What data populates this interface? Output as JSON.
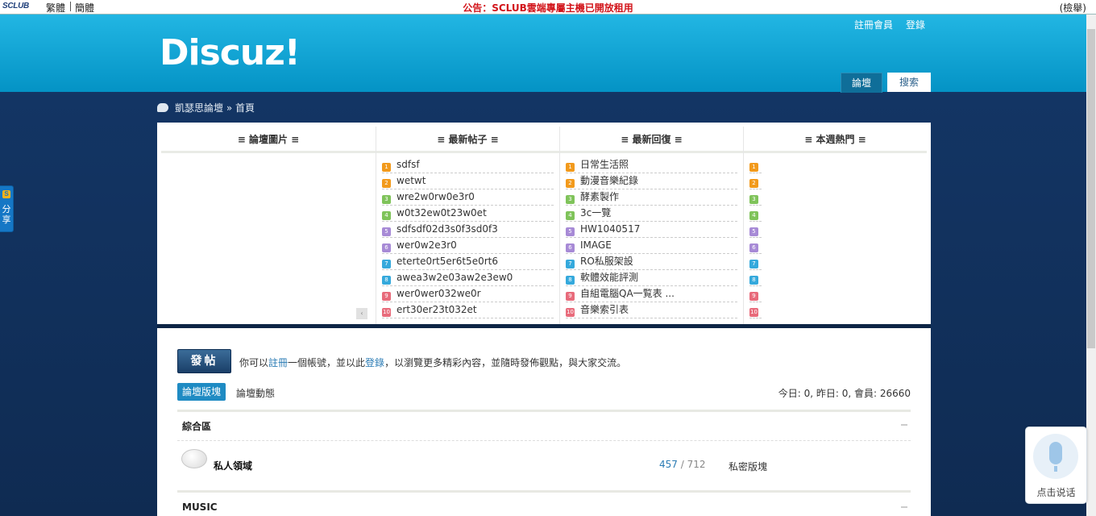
{
  "topbar": {
    "brand": "SCLUB",
    "lang_trad": "繁體",
    "lang_simp": "簡體",
    "announcement": "公告：SCLUB雲端專屬主機已開放租用",
    "lookup": "(檢舉)"
  },
  "header": {
    "logo": "Discuz!",
    "register": "註冊會員",
    "login": "登錄",
    "nav": [
      "論壇",
      "搜索"
    ]
  },
  "breadcrumb": {
    "site": "凱瑟思論壇",
    "sep": "»",
    "current": "首頁"
  },
  "portal": {
    "columns": [
      {
        "title": "≡ 論壇圖片 ≡",
        "items": []
      },
      {
        "title": "≡ 最新帖子 ≡",
        "items": [
          "sdfsf",
          "wetwt",
          "wre2w0rw0e3r0",
          "w0t32ew0t23w0et",
          "sdfsdf02d3s0f3sd0f3",
          "wer0w2e3r0",
          "eterte0rt5er6t5e0rt6",
          "awea3w2e03aw2e3ew0",
          "wer0wer032we0r",
          "ert30er23t032et"
        ]
      },
      {
        "title": "≡ 最新回復 ≡",
        "items": [
          "日常生活照",
          "動漫音樂紀錄",
          "酵素製作",
          "3c一覽",
          "HW1040517",
          "IMAGE",
          "RO私服架設",
          "軟體效能評測",
          "自組電腦QA一覧表 ...",
          "音樂索引表"
        ]
      },
      {
        "title": "≡ 本週熱門 ≡",
        "items": [
          "",
          "",
          "",
          "",
          "",
          "",
          "",
          "",
          "",
          ""
        ]
      }
    ],
    "rank_numbers": [
      "1",
      "2",
      "3",
      "4",
      "5",
      "6",
      "7",
      "8",
      "9",
      "10"
    ],
    "rank_colors": [
      "#f29a1c",
      "#f29a1c",
      "#7fc35a",
      "#7fc35a",
      "#a78ad6",
      "#a78ad6",
      "#35a9dc",
      "#35a9dc",
      "#e86b7b",
      "#e86b7b"
    ],
    "pager": "‹"
  },
  "main": {
    "post_button": "發帖",
    "notice": {
      "prefix": "你可以",
      "register": "註冊",
      "mid": "一個帳號，並以此",
      "login": "登錄",
      "suffix": "，以瀏覽更多精彩內容，並隨時發佈觀點，與大家交流。"
    },
    "tabs": [
      "論壇版塊",
      "論壇動態"
    ],
    "stats": "今日: 0, 昨日: 0, 會員: 26660",
    "categories": [
      {
        "title": "綜合區"
      },
      {
        "title": "MUSIC"
      }
    ],
    "forum": {
      "name": "私人領域",
      "threads": "457",
      "slash": " / ",
      "posts": "712",
      "last": "私密版塊"
    }
  },
  "share": {
    "letter": "S",
    "label": "分享"
  },
  "voice": {
    "label": "点击说话"
  }
}
